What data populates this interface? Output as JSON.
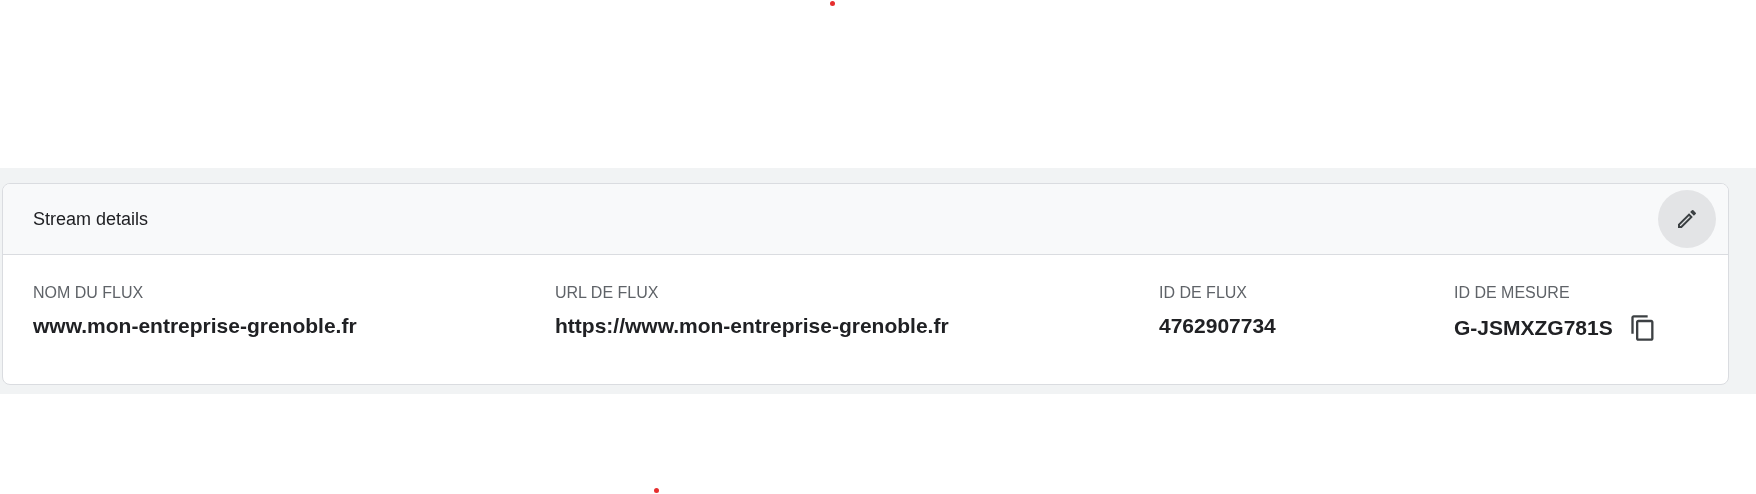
{
  "card": {
    "title": "Stream details"
  },
  "fields": [
    {
      "label": "NOM DU FLUX",
      "value": "www.mon-entreprise-grenoble.fr",
      "copyable": false
    },
    {
      "label": "URL DE FLUX",
      "value": "https://www.mon-entreprise-grenoble.fr",
      "copyable": false
    },
    {
      "label": "ID DE FLUX",
      "value": "4762907734",
      "copyable": false
    },
    {
      "label": "ID DE MESURE",
      "value": "G-JSMXZG781S",
      "copyable": true
    }
  ]
}
